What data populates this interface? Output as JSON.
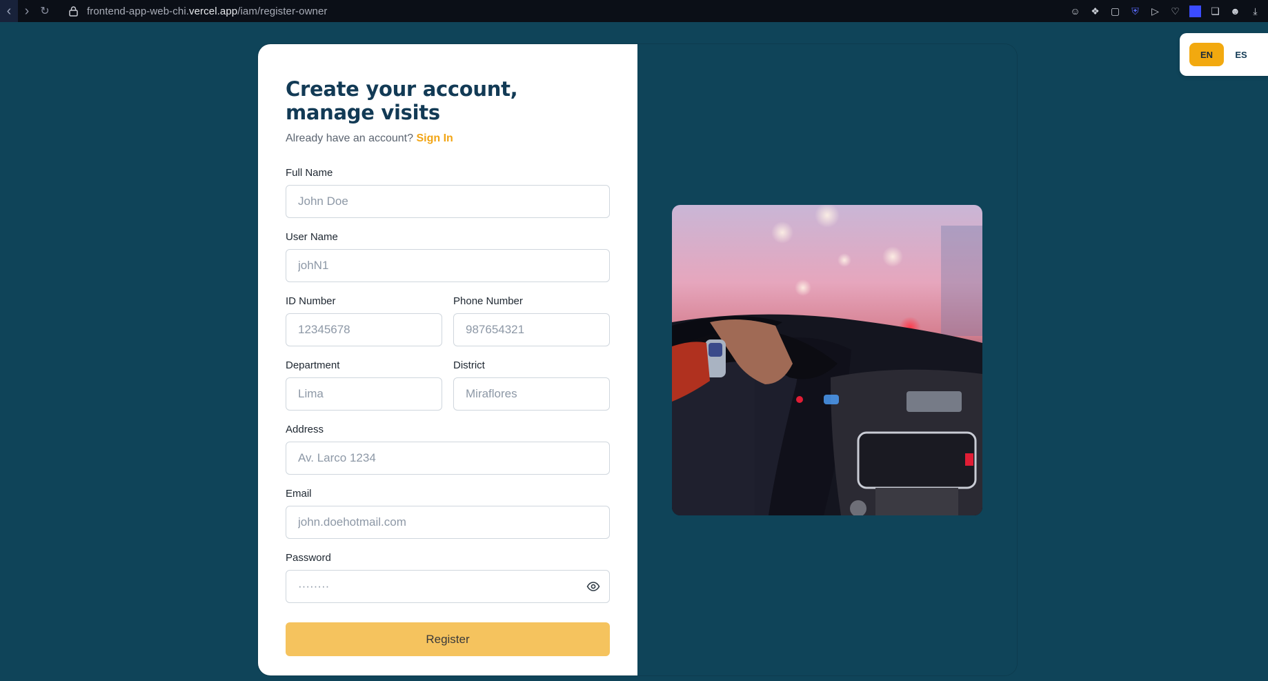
{
  "browser": {
    "url_prefix": "frontend-app-web-chi.",
    "url_domain": "vercel.app",
    "url_path": "/iam/register-owner"
  },
  "form": {
    "title": "Create your account, manage visits",
    "subtitle_text": "Already have an account?",
    "signin_link": "Sign In",
    "full_name": {
      "label": "Full Name",
      "placeholder": "John Doe"
    },
    "user_name": {
      "label": "User Name",
      "placeholder": "johN1"
    },
    "id_number": {
      "label": "ID Number",
      "placeholder": "12345678"
    },
    "phone_number": {
      "label": "Phone Number",
      "placeholder": "987654321"
    },
    "department": {
      "label": "Department",
      "placeholder": "Lima"
    },
    "district": {
      "label": "District",
      "placeholder": "Miraflores"
    },
    "address": {
      "label": "Address",
      "placeholder": "Av. Larco 1234"
    },
    "email": {
      "label": "Email",
      "placeholder": "john.doehotmail.com"
    },
    "password": {
      "label": "Password",
      "placeholder": "········"
    },
    "register_button": "Register"
  },
  "language": {
    "options": [
      "EN",
      "ES"
    ],
    "selected": "EN"
  },
  "colors": {
    "background": "#0f4459",
    "accent": "#f2a515",
    "button": "#f5c35e",
    "title": "#123a55"
  }
}
